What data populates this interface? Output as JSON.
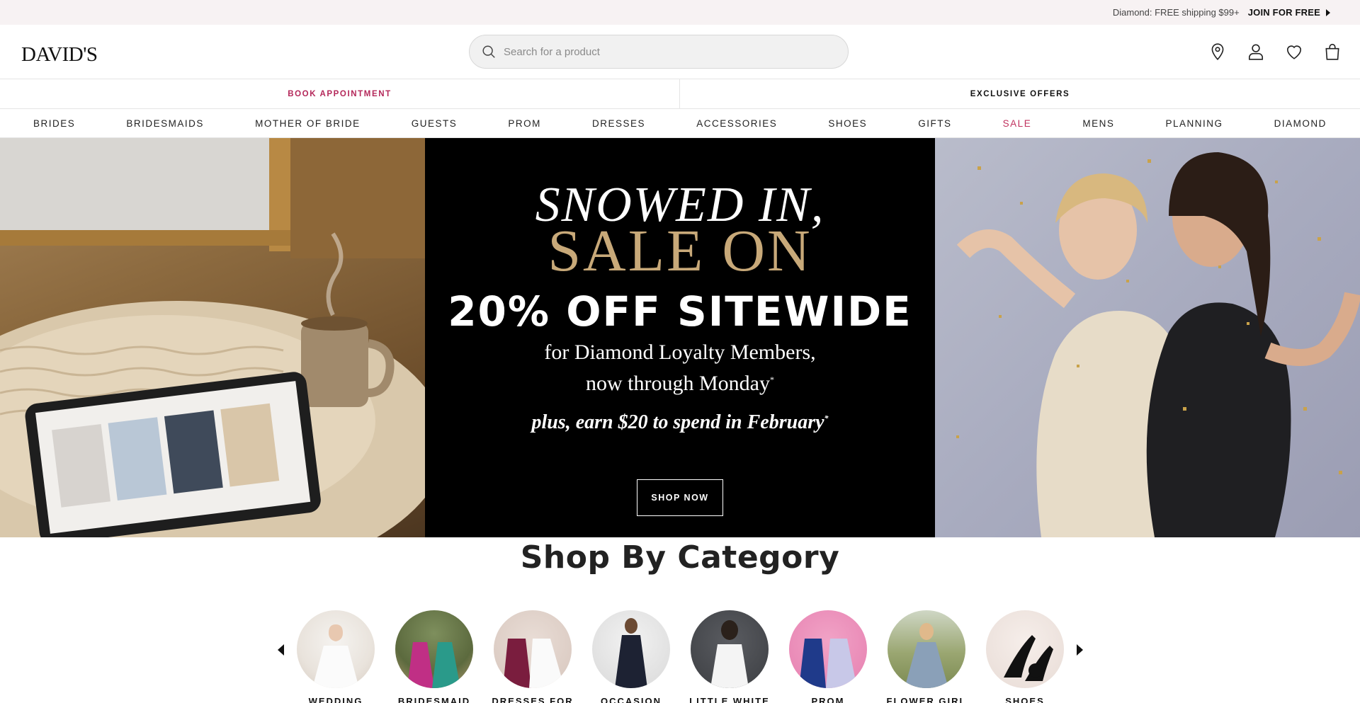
{
  "promo": {
    "text": "Diamond: FREE shipping $99+",
    "join_label": "JOIN FOR FREE"
  },
  "header": {
    "logo": "DAVID'S",
    "search_placeholder": "Search for a product",
    "icons": [
      "location-pin-icon",
      "user-icon",
      "heart-icon",
      "shopping-bag-icon"
    ]
  },
  "sub_bar": {
    "left_label": "BOOK APPOINTMENT",
    "right_label": "EXCLUSIVE OFFERS"
  },
  "nav": {
    "items": [
      {
        "label": "BRIDES"
      },
      {
        "label": "BRIDESMAIDS"
      },
      {
        "label": "MOTHER OF BRIDE"
      },
      {
        "label": "GUESTS"
      },
      {
        "label": "PROM"
      },
      {
        "label": "DRESSES"
      },
      {
        "label": "ACCESSORIES"
      },
      {
        "label": "SHOES"
      },
      {
        "label": "GIFTS"
      },
      {
        "label": "SALE"
      },
      {
        "label": "MENS"
      },
      {
        "label": "PLANNING"
      },
      {
        "label": "DIAMOND"
      }
    ]
  },
  "hero": {
    "line1": "SNOWED IN,",
    "line2": "SALE ON",
    "line3": "20% OFF SITEWIDE",
    "line4a": "for Diamond Loyalty Members,",
    "line4b": "now through Monday",
    "line5": "plus, earn $20 to spend in February",
    "asterisk": "*",
    "cta": "SHOP NOW"
  },
  "categories": {
    "title": "Shop By Category",
    "items": [
      {
        "label": "WEDDING"
      },
      {
        "label": "BRIDESMAID"
      },
      {
        "label": "DRESSES FOR"
      },
      {
        "label": "OCCASION"
      },
      {
        "label": "LITTLE WHITE"
      },
      {
        "label": "PROM"
      },
      {
        "label": "FLOWER GIRL"
      },
      {
        "label": "SHOES"
      }
    ]
  },
  "colors": {
    "promo_bg": "#f7f2f3",
    "accent_pink": "#c0315e",
    "gold": "#c8a979",
    "hero_center_bg": "#000000"
  }
}
